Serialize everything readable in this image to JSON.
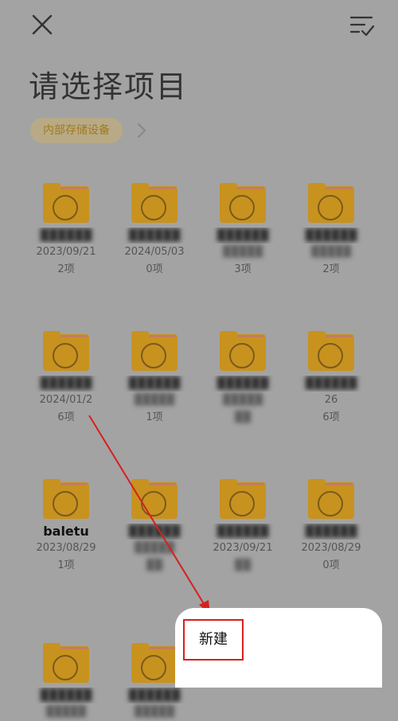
{
  "header": {
    "title": "请选择项目",
    "close_icon": "close-icon",
    "sort_icon": "sort-check-icon"
  },
  "breadcrumb": {
    "chip_label": "内部存储设备"
  },
  "folders": [
    {
      "name": "",
      "date": "2023/09/21",
      "count": "2项"
    },
    {
      "name": "",
      "date": "2024/05/03",
      "count": "0项"
    },
    {
      "name": "",
      "date": "",
      "count": "3项"
    },
    {
      "name": "",
      "date": "",
      "count": "2项"
    },
    {
      "name": "",
      "date": "2024/01/2",
      "count": "6项"
    },
    {
      "name": "",
      "date": "",
      "count": "1项"
    },
    {
      "name": "",
      "date": "",
      "count": ""
    },
    {
      "name": "",
      "date": "26",
      "count": "6项"
    },
    {
      "name": "baletu",
      "date": "2023/08/29",
      "count": "1项"
    },
    {
      "name": "",
      "date": "",
      "count": ""
    },
    {
      "name": "",
      "date": "2023/09/21",
      "count": ""
    },
    {
      "name": "",
      "date": "2023/08/29",
      "count": "0项"
    },
    {
      "name": "",
      "date": "",
      "count": ""
    },
    {
      "name": "",
      "date": "",
      "count": ""
    }
  ],
  "popup": {
    "new_label": "新建"
  },
  "colors": {
    "folder": "#c8921f",
    "annotation": "#d62020",
    "overlay": "#a3a3a3"
  }
}
